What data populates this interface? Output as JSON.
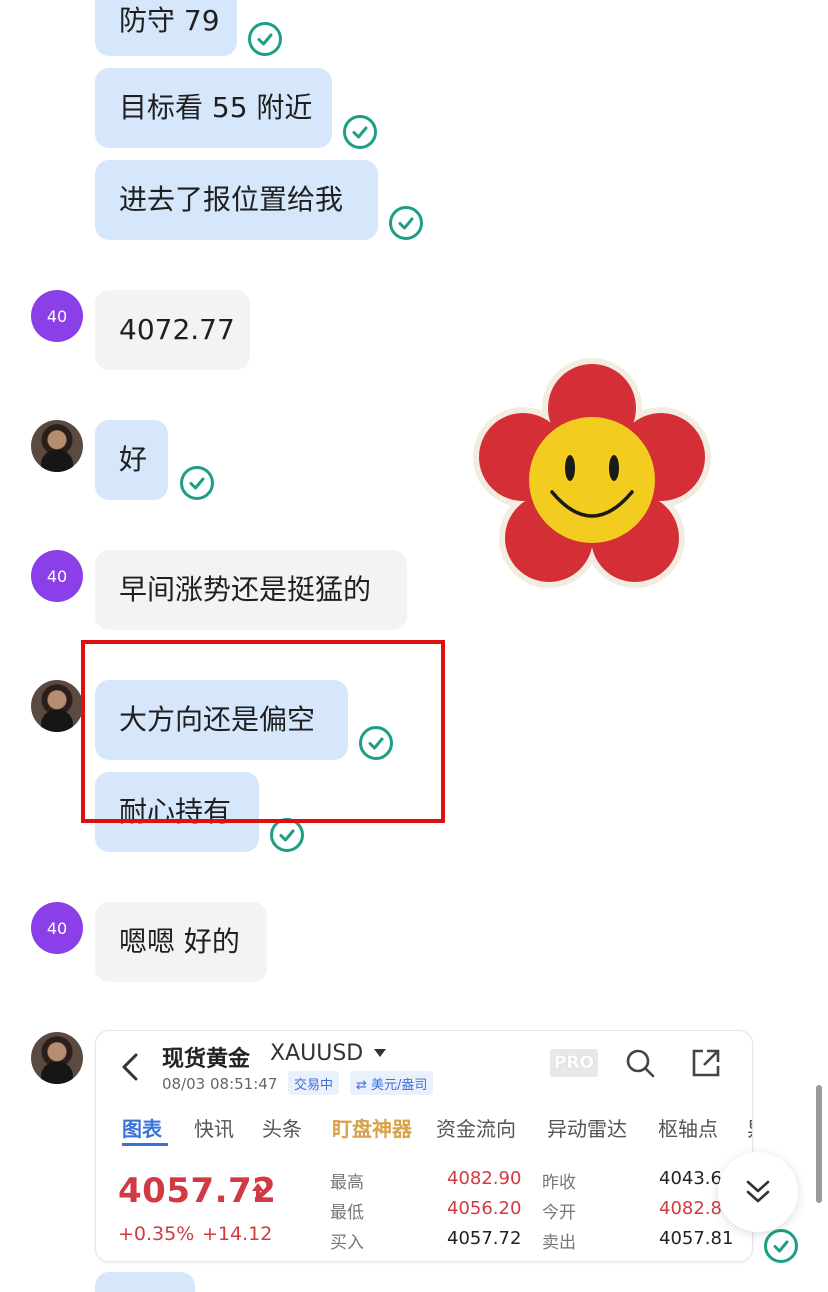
{
  "messages": {
    "m1": {
      "text": "防守 79"
    },
    "m2": {
      "text": "目标看 55 附近"
    },
    "m3": {
      "text": "进去了报位置给我"
    },
    "m4": {
      "text": "4072.77",
      "sender_badge": "40"
    },
    "m5": {
      "text": "好"
    },
    "m6": {
      "text": "早间涨势还是挺猛的",
      "sender_badge": "40"
    },
    "m7": {
      "text": "大方向还是偏空"
    },
    "m8": {
      "text": "耐心持有"
    },
    "m9": {
      "text": "嗯嗯 好的",
      "sender_badge": "40"
    }
  },
  "quote_card": {
    "title": "现货黄金",
    "symbol": "XAUUSD",
    "datetime": "08/03 08:51:47",
    "status_tag": "交易中",
    "currency_tag": "⇄ 美元/盎司",
    "pro_label": "PRO",
    "tabs": [
      "图表",
      "快讯",
      "头条",
      "盯盘神器",
      "资金流向",
      "异动雷达",
      "枢轴点",
      "异"
    ],
    "price": "4057.72",
    "change_pct": "+0.35%",
    "change_abs": "+14.12",
    "stats": {
      "high_label": "最高",
      "high": "4082.90",
      "low_label": "最低",
      "low": "4056.20",
      "bid_label": "买入",
      "bid": "4057.72",
      "prev_close_label": "昨收",
      "prev_close": "4043.6",
      "open_label": "今开",
      "open": "4082.8",
      "ask_label": "卖出",
      "ask": "4057.81"
    }
  },
  "colors": {
    "outgoing_bubble": "#d6e6fb",
    "incoming_bubble": "#f1f3f5",
    "read_check": "#1d9e86",
    "badge": "#8a3fe8",
    "highlight_box": "#e01010",
    "price_up": "#d23a43",
    "tab_active": "#3a72db"
  },
  "icons": [
    "read-check-icon",
    "back-arrow-icon",
    "search-icon",
    "share-icon",
    "price-up-arrow-icon",
    "scroll-down-icon",
    "smiley-flower-sticker"
  ]
}
